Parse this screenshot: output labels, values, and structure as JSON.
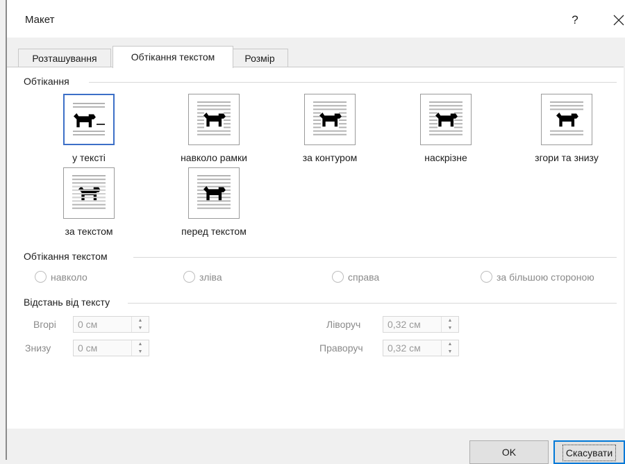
{
  "window": {
    "title": "Макет",
    "help_label": "?",
    "close_icon": "close-icon"
  },
  "tabs": [
    {
      "label": "Розташування",
      "active": false
    },
    {
      "label": "Обтікання текстом",
      "active": true
    },
    {
      "label": "Розмір",
      "active": false
    }
  ],
  "wrapping_style": {
    "heading": "Обтікання",
    "options": [
      {
        "label": "у тексті",
        "selected": true,
        "icon": "inline-with-text-icon"
      },
      {
        "label": "навколо рамки",
        "selected": false,
        "icon": "square-wrap-icon"
      },
      {
        "label": "за контуром",
        "selected": false,
        "icon": "tight-wrap-icon"
      },
      {
        "label": "наскрізне",
        "selected": false,
        "icon": "through-wrap-icon"
      },
      {
        "label": "згори та знизу",
        "selected": false,
        "icon": "top-and-bottom-icon"
      },
      {
        "label": "за текстом",
        "selected": false,
        "icon": "behind-text-icon"
      },
      {
        "label": "перед текстом",
        "selected": false,
        "icon": "in-front-of-text-icon"
      }
    ]
  },
  "wrap_text": {
    "heading": "Обтікання текстом",
    "options": [
      "навколо",
      "зліва",
      "справа",
      "за більшою стороною"
    ]
  },
  "distance": {
    "heading": "Відстань від тексту",
    "top": {
      "label": "Вгорі",
      "value": "0 см"
    },
    "bottom": {
      "label": "Знизу",
      "value": "0 см"
    },
    "left": {
      "label": "Ліворуч",
      "value": "0,32 см"
    },
    "right": {
      "label": "Праворуч",
      "value": "0,32 см"
    }
  },
  "buttons": {
    "ok": "OK",
    "cancel": "Скасувати"
  },
  "colors": {
    "accent": "#0078d7",
    "selection_border": "#3c6fc7"
  }
}
